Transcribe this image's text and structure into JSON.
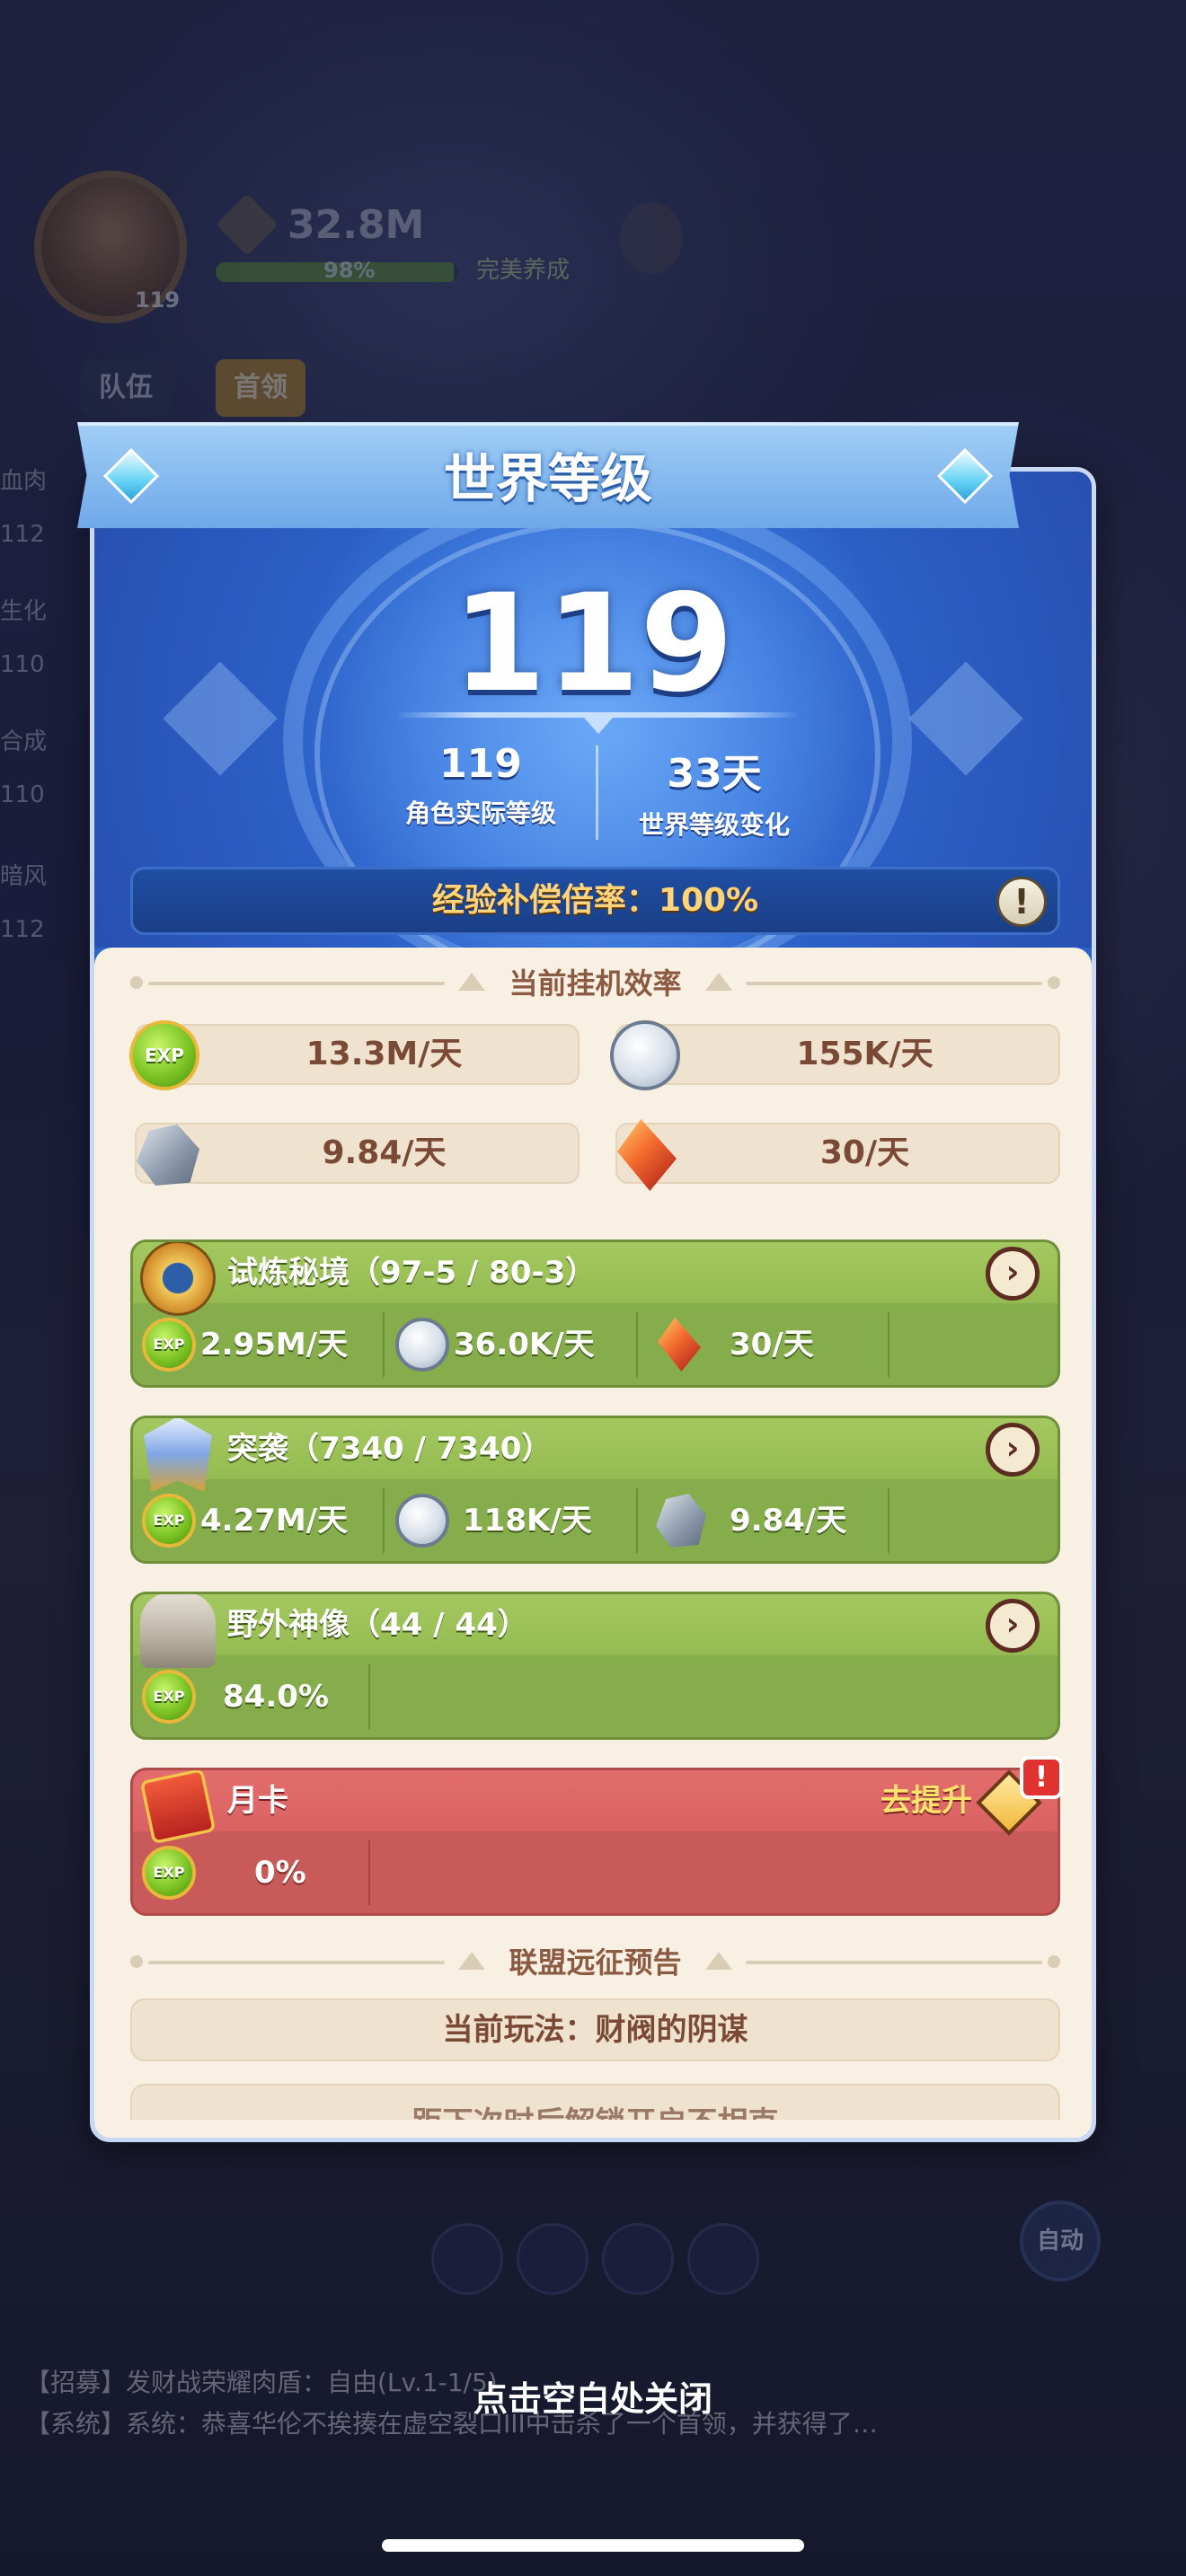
{
  "background": {
    "hud": {
      "avatar_level": "119",
      "power_value": "32.8M",
      "power_percent": "98%",
      "upgrade_label": "完美养成"
    },
    "tabs": [
      {
        "label": "队伍"
      },
      {
        "label": "首领"
      }
    ],
    "side_stats": [
      "血肉",
      "112",
      "生化",
      "110",
      "合成",
      "110",
      "暗风",
      "112"
    ],
    "auto_label": "自动",
    "log_lines": [
      "【招募】发财战荣耀肉盾：自由(Lv.1-1/5)",
      "【系统】系统：恭喜华伦不挨揍在虚空裂口III中击杀了一个首领，并获得了…"
    ]
  },
  "modal": {
    "title": "世界等级",
    "world_level": "119",
    "stats": [
      {
        "value": "119",
        "label": "角色实际等级"
      },
      {
        "value": "33天",
        "label": "世界等级变化"
      }
    ],
    "exp_compensation": "经验补偿倍率：100%",
    "idle_section": {
      "title": "当前挂机效率",
      "rates": [
        {
          "icon": "exp-icon",
          "text": "13.3M/天"
        },
        {
          "icon": "coin-icon",
          "text": "155K/天"
        },
        {
          "icon": "ore-icon",
          "text": "9.84/天"
        },
        {
          "icon": "crystal-icon",
          "text": "30/天"
        }
      ]
    },
    "cards": [
      {
        "title": "试炼秘境（97-5 / 80-3）",
        "icon": "trial-realm-icon",
        "cells": [
          {
            "icon": "exp-icon",
            "text": "2.95M/天"
          },
          {
            "icon": "coin-icon",
            "text": "36.0K/天"
          },
          {
            "icon": "crystal-icon",
            "text": "30/天"
          }
        ]
      },
      {
        "title": "突袭（7340 / 7340）",
        "icon": "raid-icon",
        "cells": [
          {
            "icon": "exp-icon",
            "text": "4.27M/天"
          },
          {
            "icon": "coin-icon",
            "text": "118K/天"
          },
          {
            "icon": "ore-icon",
            "text": "9.84/天"
          }
        ]
      },
      {
        "title": "野外神像（44 / 44）",
        "icon": "statue-icon",
        "cells": [
          {
            "icon": "exp-icon",
            "text": "84.0%"
          }
        ]
      }
    ],
    "monthly_card": {
      "title": "月卡",
      "icon": "monthly-card-icon",
      "upgrade_label": "去提升",
      "alert": "!",
      "cells": [
        {
          "icon": "exp-icon",
          "text": "0%"
        }
      ]
    },
    "alliance_section": {
      "title": "联盟远征预告",
      "current": "当前玩法：财阀的阴谋",
      "next_partial": "距下次时后解锁开启不相克"
    },
    "close_hint": "点击空白处关闭",
    "colors": {
      "hero_blue": "#2d63c9",
      "card_green": "#86ad4b",
      "card_red": "#c95a5a",
      "cream": "#f8f0e2",
      "exp_gold": "#ffd37a"
    }
  }
}
